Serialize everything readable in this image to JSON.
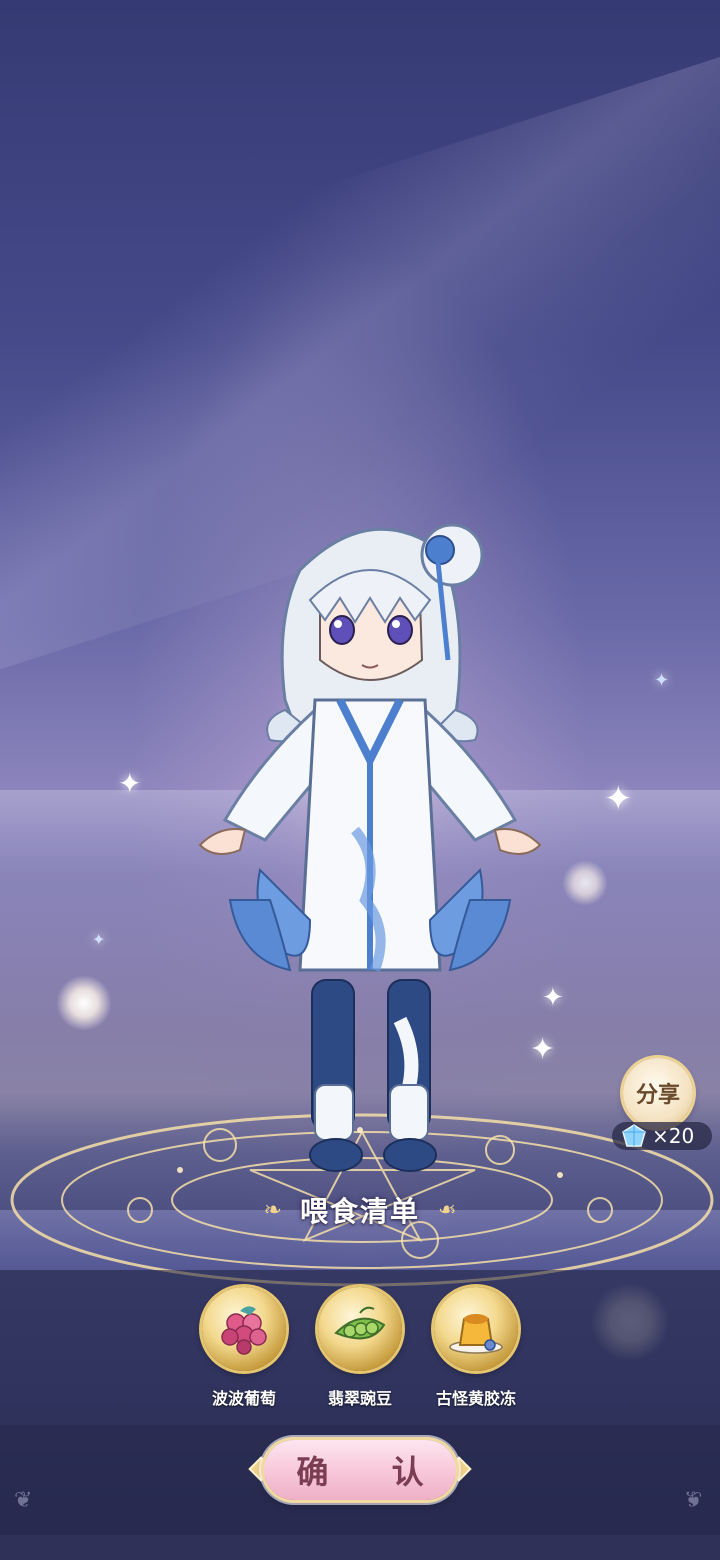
{
  "feed_panel": {
    "title": "喂食清单",
    "items": [
      {
        "label": "波波葡萄",
        "icon": "grape-icon"
      },
      {
        "label": "翡翠豌豆",
        "icon": "pea-pod-icon"
      },
      {
        "label": "古怪黄胶冻",
        "icon": "pudding-icon"
      }
    ],
    "confirm_label": "确 认"
  },
  "share": {
    "label": "分享",
    "reward_icon": "crystal-icon",
    "reward_count": "×20"
  },
  "colors": {
    "accent_gold": "#f1d38f",
    "button_pink": "#f7c6d8"
  }
}
